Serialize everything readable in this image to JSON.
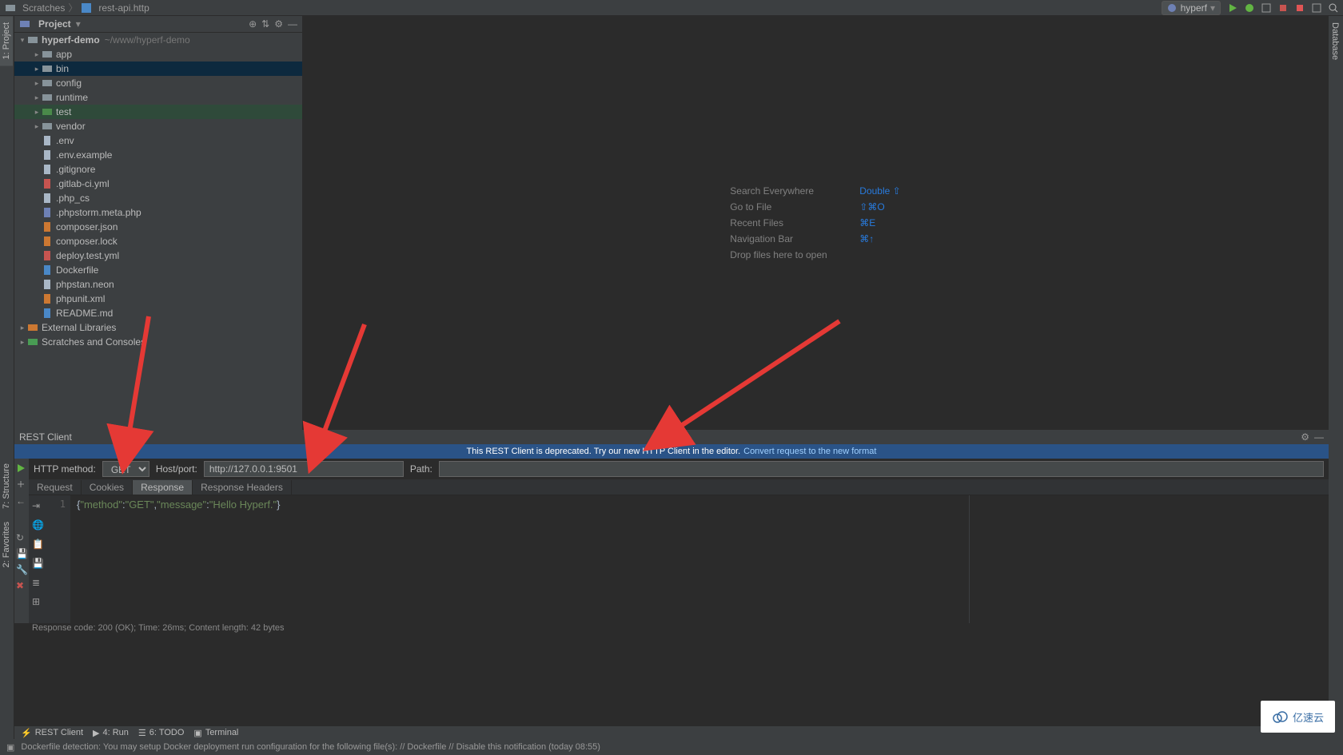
{
  "breadcrumb": {
    "scratches": "Scratches",
    "file": "rest-api.http"
  },
  "run_config": "hyperf",
  "project_title": "Project",
  "side_tabs": {
    "project": "1: Project",
    "structure": "7: Structure",
    "favorites": "2: Favorites",
    "database": "Database"
  },
  "tree": {
    "root": "hyperf-demo",
    "root_hint": "~/www/hyperf-demo",
    "folders": [
      "app",
      "bin",
      "config",
      "runtime",
      "test",
      "vendor"
    ],
    "files": [
      ".env",
      ".env.example",
      ".gitignore",
      ".gitlab-ci.yml",
      ".php_cs",
      ".phpstorm.meta.php",
      "composer.json",
      "composer.lock",
      "deploy.test.yml",
      "Dockerfile",
      "phpstan.neon",
      "phpunit.xml",
      "README.md"
    ],
    "ext": "External Libraries",
    "scratch": "Scratches and Consoles"
  },
  "welcome": [
    {
      "label": "Search Everywhere",
      "key": "Double ⇧"
    },
    {
      "label": "Go to File",
      "key": "⇧⌘O"
    },
    {
      "label": "Recent Files",
      "key": "⌘E"
    },
    {
      "label": "Navigation Bar",
      "key": "⌘↑"
    },
    {
      "label": "Drop files here to open",
      "key": ""
    }
  ],
  "rest": {
    "panel_title": "REST Client",
    "deprec": "This REST Client is deprecated. Try our new HTTP Client in the editor.",
    "deprec_link": "Convert request to the new format",
    "method_label": "HTTP method:",
    "method": "GET",
    "host_label": "Host/port:",
    "host": "http://127.0.0.1:9501",
    "path_label": "Path:",
    "path": "",
    "tabs": [
      "Request",
      "Cookies",
      "Response",
      "Response Headers"
    ],
    "resp_json": {
      "method": "GET",
      "message": "Hello Hyperf."
    },
    "status": "Response code: 200 (OK); Time: 26ms; Content length: 42 bytes"
  },
  "bottom_tabs": [
    {
      "icon": "rest",
      "label": "REST Client"
    },
    {
      "icon": "run",
      "label": "4: Run"
    },
    {
      "icon": "todo",
      "label": "6: TODO"
    },
    {
      "icon": "term",
      "label": "Terminal"
    }
  ],
  "statusbar": "Dockerfile detection: You may setup Docker deployment run configuration for the following file(s): // Dockerfile // Disable this notification (today 08:55)",
  "watermark": "亿速云"
}
